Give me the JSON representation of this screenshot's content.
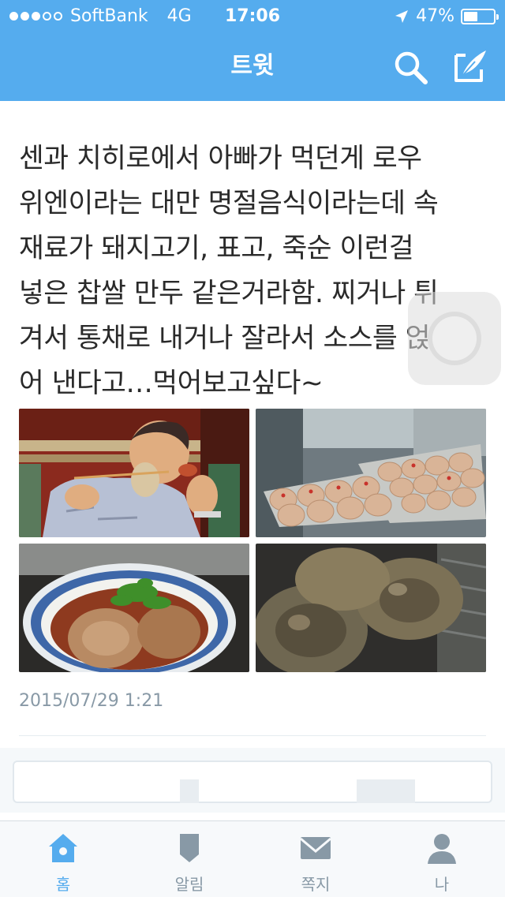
{
  "status_bar": {
    "signal_dots_filled": 3,
    "signal_dots_total": 5,
    "carrier": "SoftBank",
    "network": "4G",
    "time": "17:06",
    "battery_text": "47%",
    "battery_level": 0.47
  },
  "nav": {
    "title": "트윗",
    "search_icon": "search-icon",
    "compose_icon": "compose-icon"
  },
  "tweet": {
    "text": "센과 치히로에서 아빠가 먹던게 로우\n위엔이라는 대만 명절음식이라는데 속\n재료가 돼지고기, 표고, 죽순 이런걸\n넣은 찹쌀 만두 같은거라함. 찌거나 튀\n겨서 통채로 내거나 잘라서 소스를 얹\n어 낸다고…먹어보고싶다~",
    "timestamp": "2015/07/29 1:21"
  },
  "tab_bar": {
    "items": [
      {
        "label": "홈",
        "icon": "home-icon",
        "active": true
      },
      {
        "label": "알림",
        "icon": "bell-icon",
        "active": false
      },
      {
        "label": "쪽지",
        "icon": "envelope-icon",
        "active": false
      },
      {
        "label": "나",
        "icon": "person-icon",
        "active": false
      }
    ]
  },
  "colors": {
    "accent": "#55acee",
    "text": "#2a2a2a",
    "muted": "#8899a6"
  }
}
